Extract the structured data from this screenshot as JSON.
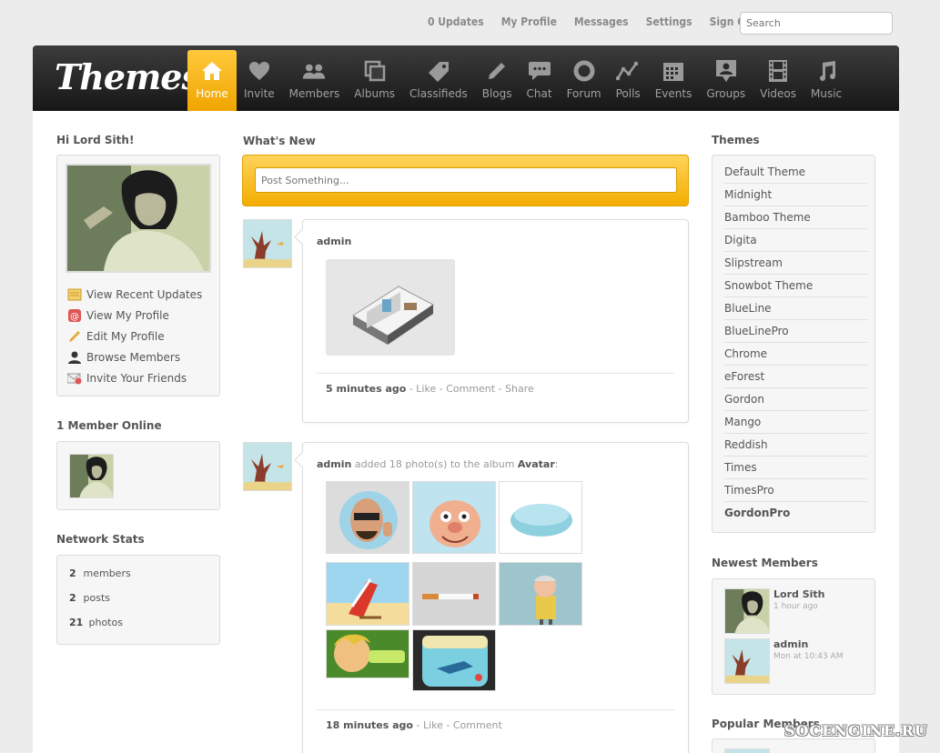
{
  "top_links": [
    "0 Updates",
    "My Profile",
    "Messages",
    "Settings",
    "Sign Out"
  ],
  "search": {
    "placeholder": "Search"
  },
  "logo": "Themes",
  "nav": [
    "Home",
    "Invite",
    "Members",
    "Albums",
    "Classifieds",
    "Blogs",
    "Chat",
    "Forum",
    "Polls",
    "Events",
    "Groups",
    "Videos",
    "Music"
  ],
  "left": {
    "greeting": "Hi Lord Sith!",
    "menu": [
      "View Recent Updates",
      "View My Profile",
      "Edit My Profile",
      "Browse Members",
      "Invite Your Friends"
    ],
    "online_title": "1 Member Online",
    "stats_title": "Network Stats",
    "stats": [
      {
        "num": "2",
        "label": "members"
      },
      {
        "num": "2",
        "label": "posts"
      },
      {
        "num": "21",
        "label": "photos"
      }
    ]
  },
  "center": {
    "title": "What's New",
    "post_placeholder": "Post Something...",
    "post1": {
      "author": "admin",
      "time": "5 minutes ago",
      "actions": [
        "Like",
        "Comment",
        "Share"
      ]
    },
    "post2": {
      "author": "admin",
      "text": "added 18 photo(s) to the album",
      "album": "Avatar",
      "time": "18 minutes ago",
      "actions": [
        "Like",
        "Comment"
      ]
    }
  },
  "right": {
    "themes_title": "Themes",
    "themes": [
      "Default Theme",
      "Midnight",
      "Bamboo Theme",
      "Digita",
      "Slipstream",
      "Snowbot Theme",
      "BlueLine",
      "BlueLinePro",
      "Chrome",
      "eForest",
      "Gordon",
      "Mango",
      "Reddish",
      "Times",
      "TimesPro",
      "GordonPro"
    ],
    "newest_title": "Newest Members",
    "newest": [
      {
        "name": "Lord Sith",
        "time": "1 hour ago"
      },
      {
        "name": "admin",
        "time": "Mon at 10:43 AM"
      }
    ],
    "popular_title": "Popular Members"
  },
  "watermark": "SOCENGINE.RU",
  "colors": {
    "accent": "#f5b400",
    "header_dark": "#1e1e1e"
  }
}
